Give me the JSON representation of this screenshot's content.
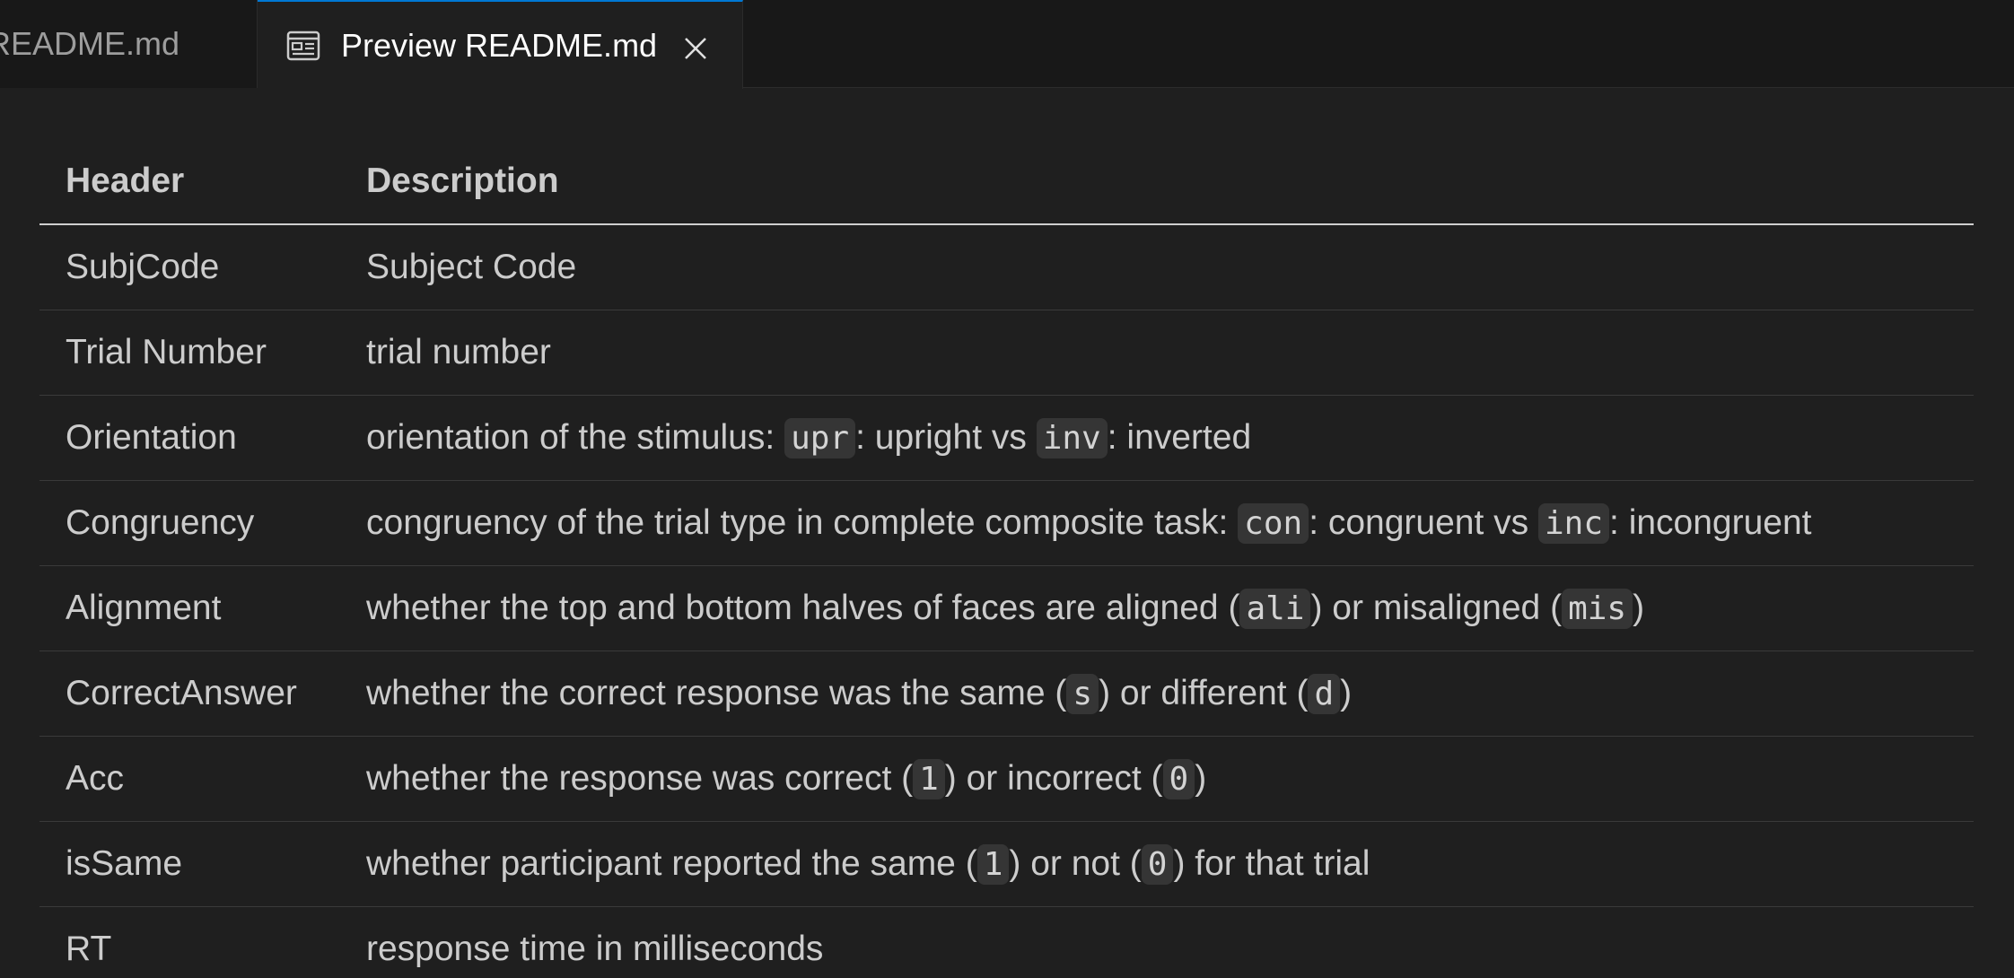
{
  "tabs": [
    {
      "label": "README.md",
      "active": false
    },
    {
      "label": "Preview README.md",
      "active": true
    }
  ],
  "icons": {
    "preview": "preview-icon",
    "close": "close-icon"
  },
  "colors": {
    "accent": "#0078d4",
    "background": "#1f1f1f",
    "tabbar": "#181818",
    "code_bg": "#353535"
  },
  "table": {
    "headers": [
      "Header",
      "Description"
    ],
    "rows": [
      {
        "header": "SubjCode",
        "description": [
          {
            "text": "Subject Code"
          }
        ]
      },
      {
        "header": "Trial Number",
        "description": [
          {
            "text": "trial number"
          }
        ]
      },
      {
        "header": "Orientation",
        "description": [
          {
            "text": "orientation of the stimulus: "
          },
          {
            "code": "upr"
          },
          {
            "text": ": upright vs "
          },
          {
            "code": "inv"
          },
          {
            "text": ": inverted"
          }
        ]
      },
      {
        "header": "Congruency",
        "description": [
          {
            "text": "congruency of the trial type in complete composite task: "
          },
          {
            "code": "con"
          },
          {
            "text": ": congruent vs "
          },
          {
            "code": "inc"
          },
          {
            "text": ": incongruent"
          }
        ]
      },
      {
        "header": "Alignment",
        "description": [
          {
            "text": "whether the top and bottom halves of faces are aligned ("
          },
          {
            "code": "ali"
          },
          {
            "text": ") or misaligned ("
          },
          {
            "code": "mis"
          },
          {
            "text": ")"
          }
        ]
      },
      {
        "header": "CorrectAnswer",
        "description": [
          {
            "text": "whether the correct response was the same ("
          },
          {
            "code": "s"
          },
          {
            "text": ") or different ("
          },
          {
            "code": "d"
          },
          {
            "text": ")"
          }
        ]
      },
      {
        "header": "Acc",
        "description": [
          {
            "text": "whether the response was correct ("
          },
          {
            "code": "1"
          },
          {
            "text": ") or incorrect ("
          },
          {
            "code": "0"
          },
          {
            "text": ")"
          }
        ]
      },
      {
        "header": "isSame",
        "description": [
          {
            "text": "whether participant reported the same ("
          },
          {
            "code": "1"
          },
          {
            "text": ") or not ("
          },
          {
            "code": "0"
          },
          {
            "text": ") for that trial"
          }
        ]
      },
      {
        "header": "RT",
        "description": [
          {
            "text": "response time in milliseconds"
          }
        ]
      }
    ]
  }
}
